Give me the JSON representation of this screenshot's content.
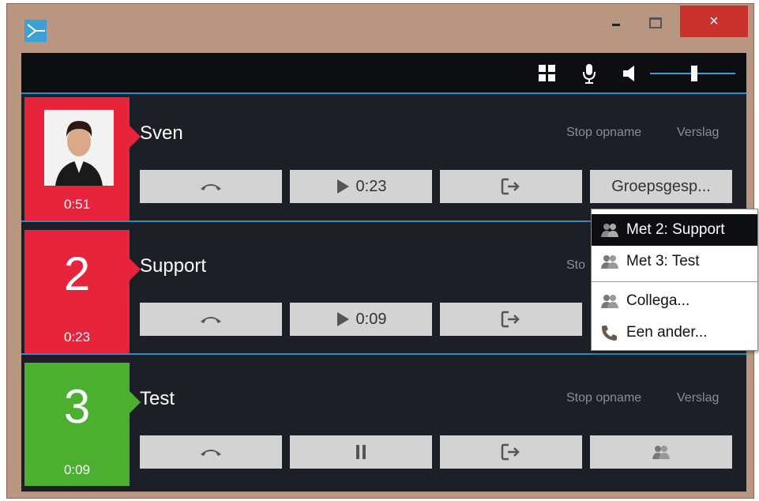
{
  "window": {
    "controls": {
      "minimize": "minimize",
      "maximize": "maximize",
      "close": "×"
    }
  },
  "toolbar": {
    "icons": [
      "grid-icon",
      "microphone-icon",
      "speaker-icon"
    ],
    "volume_level": 0.52
  },
  "calls": [
    {
      "name": "Sven",
      "timer": "0:51",
      "badge_color": "#e8243c",
      "has_avatar": true,
      "links": {
        "stop": "Stop opname",
        "report": "Verslag"
      },
      "actions": {
        "hangup": "hangup",
        "playback": "0:23",
        "transfer": "transfer",
        "group": "Groepsgesp..."
      }
    },
    {
      "name": "Support",
      "number": "2",
      "timer": "0:23",
      "badge_color": "#e8243c",
      "links": {
        "stop": "Sto"
      },
      "actions": {
        "hangup": "hangup",
        "playback": "0:09",
        "transfer": "transfer"
      }
    },
    {
      "name": "Test",
      "number": "3",
      "timer": "0:09",
      "badge_color": "#4caf2f",
      "links": {
        "stop": "Stop opname",
        "report": "Verslag"
      },
      "actions": {
        "hangup": "hangup",
        "pause": "pause",
        "transfer": "transfer",
        "group": "group"
      }
    }
  ],
  "group_menu": {
    "items": [
      {
        "label": "Met 2: Support",
        "icon": "group-icon",
        "selected": true
      },
      {
        "label": "Met 3: Test",
        "icon": "group-icon",
        "selected": false
      },
      {
        "label": "Collega...",
        "icon": "group-icon",
        "selected": false
      },
      {
        "label": "Een ander...",
        "icon": "phone-icon",
        "selected": false
      }
    ]
  }
}
